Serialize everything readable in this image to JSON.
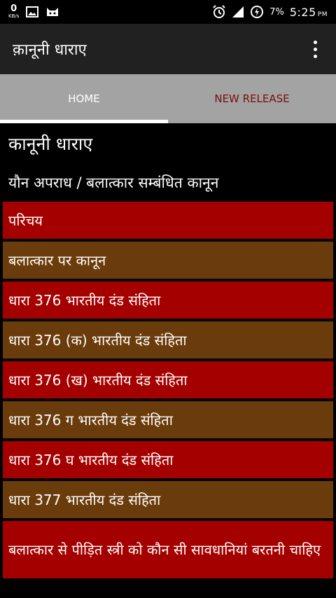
{
  "status_bar": {
    "net_speed": "0",
    "net_unit": "KB/s",
    "battery": "7%",
    "time": "5:25",
    "ampm": "PM"
  },
  "app_bar": {
    "title": "क़ानूनी धाराए"
  },
  "tabs": [
    {
      "label": "HOME",
      "selected": true
    },
    {
      "label": "NEW RELEASE",
      "selected": false
    }
  ],
  "content": {
    "section_title": "कानूनी धाराए",
    "subheader": "यौन अपराध / बलात्कार सम्बंधित कानून",
    "items": [
      {
        "label": "परिचय",
        "color": "#a50000"
      },
      {
        "label": "बलात्कार पर कानून",
        "color": "#6b3c0b"
      },
      {
        "label": "धारा 376 भारतीय दंड संहिता",
        "color": "#a50000"
      },
      {
        "label": "धारा 376 (क) भारतीय दंड संहिता",
        "color": "#6b3c0b"
      },
      {
        "label": "धारा 376 (ख) भारतीय दंड संहिता",
        "color": "#a50000"
      },
      {
        "label": "धारा 376 ग भारतीय दंड संहिता",
        "color": "#6b3c0b"
      },
      {
        "label": "धारा 376 घ भारतीय दंड संहिता",
        "color": "#a50000"
      },
      {
        "label": "धारा 377 भारतीय दंड संहिता",
        "color": "#6b3c0b"
      },
      {
        "label": "बलात्कार से पीड़ित स्त्री को कौन सी सावधानियां बरतनी चाहिए",
        "color": "#a50000"
      }
    ]
  }
}
